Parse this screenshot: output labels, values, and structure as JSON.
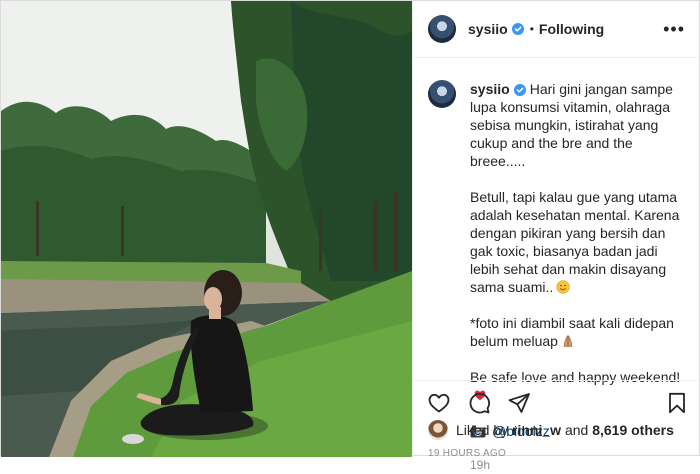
{
  "post": {
    "username": "sysiio",
    "following_label": "Following",
    "more_label": "•••",
    "caption": {
      "paragraph1": "Hari gini jangan sampe lupa konsumsi vitamin, olahraga sebisa mungkin, istirahat yang cukup and the bre and the breee.....",
      "paragraph2": "Betull, tapi kalau gue yang utama adalah kesehatan mental. Karena dengan pikiran yang bersih dan gak toxic, biasanya badan jadi lebih sehat dan makin disayang sama suami..",
      "paragraph3": "*foto ini diambil saat kali didepan belum meluap",
      "paragraph4": "Be safe love and happy weekend!",
      "credit_mention": "@bidolzz",
      "time_ago": "19h"
    },
    "likes": {
      "prefix": "Liked by",
      "liker": "rinni_w",
      "conjunction": "and",
      "others": "8,619 others"
    },
    "date": "19 HOURS AGO",
    "icons": {
      "verified": "verified-badge-icon",
      "like": "heart-icon",
      "comment": "comment-icon",
      "share": "paper-plane-icon",
      "save": "bookmark-icon"
    },
    "colors": {
      "verified": "#3897f0",
      "text": "#262626",
      "muted": "#8e8e8e",
      "mention": "#00376b"
    }
  }
}
